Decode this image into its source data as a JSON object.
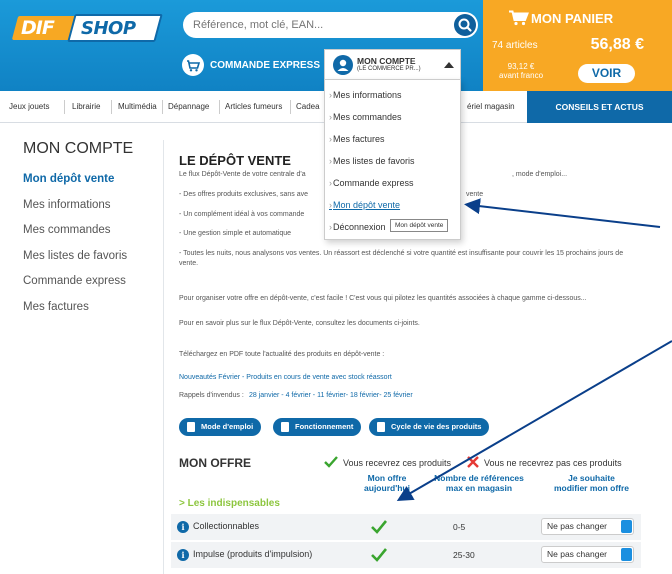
{
  "header": {
    "logo_part1": "DIF",
    "logo_part2": "SHOP",
    "search_placeholder": "Référence, mot clé, EAN...",
    "express_label": "COMMANDE EXPRESS",
    "account": {
      "label": "MON COMPTE",
      "sub": "(LE COMMERCE PR...)"
    },
    "cart": {
      "title": "MON PANIER",
      "count": "74 articles",
      "total": "56,88 €",
      "franco_amount": "93,12 €",
      "franco_note": "avant franco",
      "button": "VOIR"
    }
  },
  "nav": {
    "items": [
      "Jeux jouets",
      "Librairie",
      "Multimédia",
      "Dépannage",
      "Articles fumeurs",
      "Cadea",
      "ériel magasin"
    ],
    "cta": "CONSEILS ET ACTUS"
  },
  "dropdown": {
    "items": [
      "Mes informations",
      "Mes commandes",
      "Mes factures",
      "Mes listes de favoris",
      "Commande express",
      "Mon dépôt vente",
      "Déconnexion"
    ],
    "tooltip": "Mon dépôt vente"
  },
  "sidebar": {
    "title": "MON COMPTE",
    "links": [
      "Mon dépôt vente",
      "Mes informations",
      "Mes commandes",
      "Mes listes de favoris",
      "Commande express",
      "Mes factures"
    ]
  },
  "main": {
    "title": "LE DÉPÔT VENTE",
    "intro": "Le flux Dépôt-Vente de votre centrale d'a",
    "intro_tail": ", mode d'emploi...",
    "bullet1": "- Des offres produits exclusives, sans ave",
    "bullet1_tail": "vente",
    "bullet2": "- Un complément idéal à vos commande",
    "bullet3": "- Une gestion simple et automatique",
    "bullet4": "- Toutes les nuits, nous analysons vos ventes. Un réassort est déclenché si votre quantité est insuffisante pour couvrir les 15 prochains jours de vente.",
    "para1": "Pour organiser votre offre en dépôt-vente, c'est facile ! C'est vous qui pilotez les quantités associées à chaque gamme ci-dessous...",
    "para2": "Pour en savoir plus sur le flux Dépôt-Vente, consultez les documents ci-joints.",
    "download_label": "Téléchargez en PDF toute l'actualité des produits en dépôt-vente :",
    "download_link": "Nouveautés Février - Produits en cours de vente avec stock réassort",
    "reminders_label": "Rappels d'invendus :",
    "reminders_dates": "28 janvier - 4 février - 11 février- 18 février- 25 février",
    "buttons": [
      "Mode d'emploi",
      "Fonctionnement",
      "Cycle de vie des produits"
    ]
  },
  "offer": {
    "title": "MON OFFRE",
    "legend_yes": "Vous recevrez ces produits",
    "legend_no": "Vous ne recevrez pas ces produits",
    "col_offer": [
      "Mon offre",
      "aujourd'hui"
    ],
    "col_refs": [
      "Nombre de références",
      "max en magasin"
    ],
    "col_change": [
      "Je souhaite",
      "modifier mon offre"
    ],
    "section": "> Les indispensables",
    "rows": [
      {
        "name": "Collectionnables",
        "range": "0-5",
        "select": "Ne pas changer"
      },
      {
        "name": "Impulse (produits d'impulsion)",
        "range": "25-30",
        "select": "Ne pas changer"
      }
    ]
  },
  "colors": {
    "brand_blue": "#0f69a8",
    "header_blue": "#1b9ad9",
    "cart_orange": "#f8a824",
    "check_green": "#3aa52f",
    "cross_red": "#e53935",
    "section_green": "#8dc63f"
  }
}
